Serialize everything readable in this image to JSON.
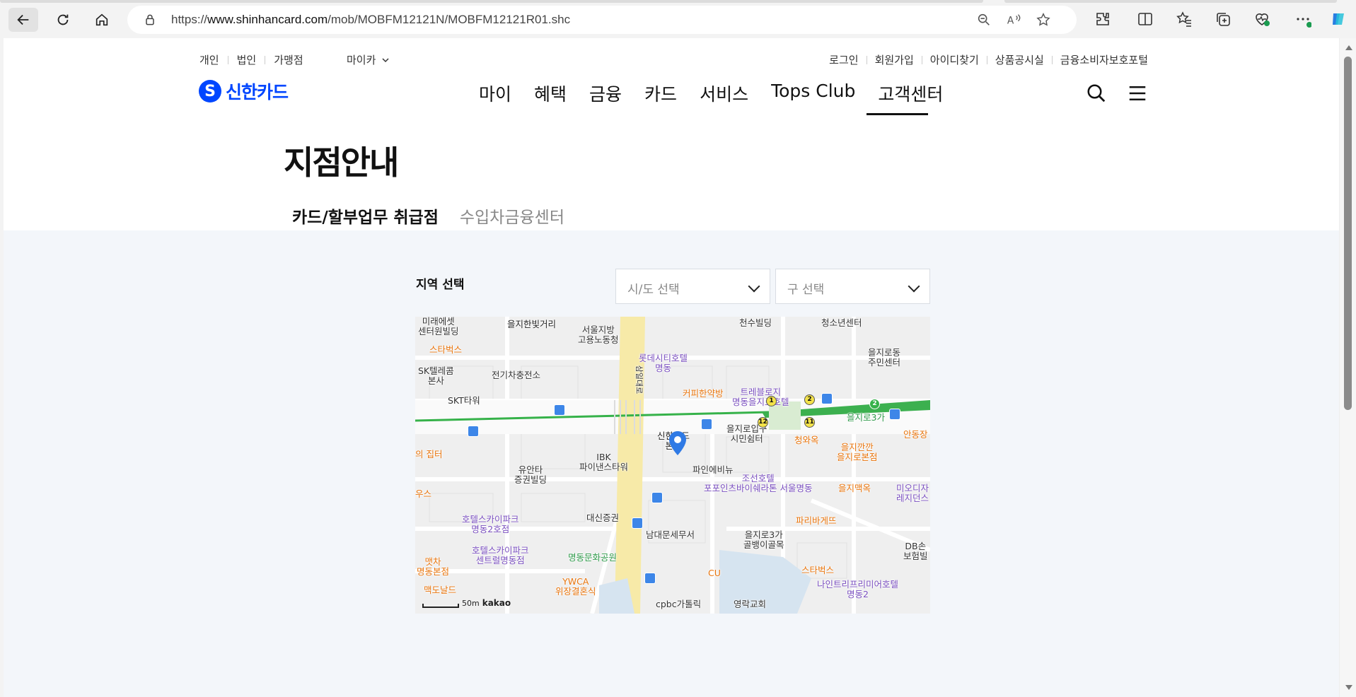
{
  "browser": {
    "url_prefix": "https://",
    "url_domain": "www.shinhancard.com",
    "url_path": "/mob/MOBFM12121N/MOBFM12121R01.shc",
    "icons": [
      "back-icon",
      "refresh-icon",
      "home-icon",
      "lock-icon",
      "zoom-icon",
      "read-aloud-icon",
      "favorite-icon",
      "extensions-icon",
      "split-screen-icon",
      "favorites-icon",
      "collections-icon",
      "browser-essentials-icon",
      "more-icon",
      "copilot-icon"
    ]
  },
  "util_nav": {
    "left": [
      "개인",
      "법인",
      "가맹점"
    ],
    "mycar": "마이카",
    "right": [
      "로그인",
      "회원가입",
      "아이디찾기",
      "상품공시실",
      "금융소비자보호포털"
    ]
  },
  "header": {
    "logo_text": "신한카드",
    "gnb": [
      "마이",
      "혜택",
      "금융",
      "카드",
      "서비스",
      "Tops Club",
      "고객센터"
    ],
    "active_gnb": "고객센터"
  },
  "page": {
    "title": "지점안내",
    "tabs": [
      "카드/할부업무 취급점",
      "수입차금융센터"
    ],
    "active_tab": "카드/할부업무 취급점",
    "region_label": "지역 선택",
    "sido_placeholder": "시/도 선택",
    "gu_placeholder": "구 선택"
  },
  "map": {
    "pois": [
      "미래에셋\n센터원빌딩",
      "을지한빛거리",
      "서울지방\n고용노동청",
      "천수빌딩",
      "청소년센터",
      "을지로동\n주민센터",
      "스타벅스",
      "롯데시티호텔\n명동",
      "SK텔레콤\n본사",
      "전기차충전소",
      "SKT타워",
      "커피한약방",
      "트레블로지\n명동을지로호텔",
      "을지로3가",
      "안동장",
      "의 집터",
      "신한카드\n본사",
      "을지로입구\n시민쉼터",
      "청와옥",
      "을지깐깐\n을지로본점",
      "유안타\n증권빌딩",
      "IBK\n파이낸스타워",
      "파인에비뉴",
      "조선호텔\n포포인츠바이쉐라톤 서울명동",
      "을지맥옥",
      "미오디자\n레지던스",
      "우스",
      "대신증권",
      "호텔스카이파크\n명동2호점",
      "남대문세무서",
      "파리바게뜨",
      "을지로3가\n골뱅이골목",
      "호텔스카이파크\n센트럴명동점",
      "명동문화공원",
      "DB손\n보험빌",
      "맷차\n명동본점",
      "YWCA\n위장결혼식",
      "CU",
      "스타벅스",
      "나인트리프리미어호텔\n명동2",
      "맥도날드",
      "cpbc가톨릭",
      "영락교회",
      "삼일대로"
    ],
    "metro_labels": [
      "1",
      "2",
      "12",
      "11",
      "2"
    ],
    "scale": "50m",
    "provider": "kakao"
  },
  "colors": {
    "brand": "#0046ff",
    "tab_underline": "#1d2b5f",
    "metro_green": "#36b24a",
    "road_yellow": "#f7eaa8"
  }
}
